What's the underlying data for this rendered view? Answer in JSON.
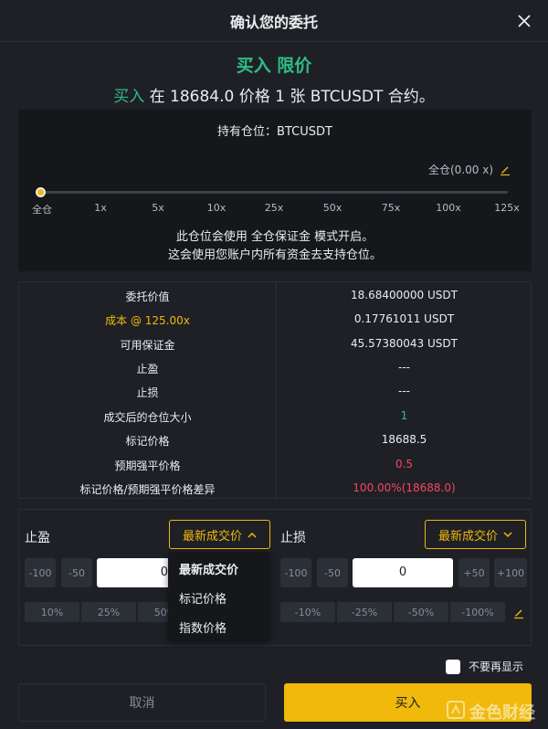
{
  "header": {
    "title": "确认您的委托",
    "close_icon": "close-icon"
  },
  "order": {
    "title": "买入 限价",
    "summary_buy": "买入",
    "summary_rest": " 在 18684.0 价格 1 张 BTCUSDT 合约。"
  },
  "position": {
    "label": "持有仓位：BTCUSDT",
    "margin_mode": "全仓(0.00 x)",
    "leverage_level": 0,
    "leverage_ticks": [
      "全仓",
      "1x",
      "5x",
      "10x",
      "25x",
      "50x",
      "75x",
      "100x",
      "125x"
    ],
    "note1": "此仓位会使用 全仓保证金 模式开启。",
    "note2": "这会使用您账户内所有资金去支持仓位。"
  },
  "info": {
    "rows": [
      {
        "label": "委托价值",
        "value": "18.68400000 USDT"
      },
      {
        "label": "成本 @ 125.00x",
        "value": "0.17761011 USDT"
      },
      {
        "label": "可用保证金",
        "value": "45.57380043 USDT"
      },
      {
        "label": "止盈",
        "value": "---"
      },
      {
        "label": "止损",
        "value": "---"
      },
      {
        "label": "成交后的仓位大小",
        "value": "1"
      },
      {
        "label": "标记价格",
        "value": "18688.5"
      },
      {
        "label": "预期强平价格",
        "value": "0.5"
      },
      {
        "label": "标记价格/预期强平价格差异",
        "value": "100.00%(18688.0)"
      }
    ]
  },
  "tpsl": {
    "tp_label": "止盈",
    "sl_label": "止损",
    "tp_select": "最新成交价",
    "sl_select": "最新成交价",
    "tp_steps": [
      "-100",
      "-50"
    ],
    "tp_value": "0",
    "sl_steps": [
      "-100",
      "-50",
      "+50",
      "+100"
    ],
    "sl_value": "0",
    "tp_pcts": [
      "10%",
      "25%",
      "50%"
    ],
    "sl_pcts": [
      "-10%",
      "-25%",
      "-50%",
      "-100%"
    ]
  },
  "dropdown": {
    "options": [
      "最新成交价",
      "标记价格",
      "指数价格"
    ]
  },
  "footer": {
    "dont_show": "不要再显示",
    "cancel": "取消",
    "buy": "买入"
  },
  "watermark": {
    "text": "金色财经"
  },
  "colors": {
    "accent": "#f0b90b",
    "buy": "#2ebd85",
    "sell": "#f6465d",
    "bg": "#1e2026"
  }
}
